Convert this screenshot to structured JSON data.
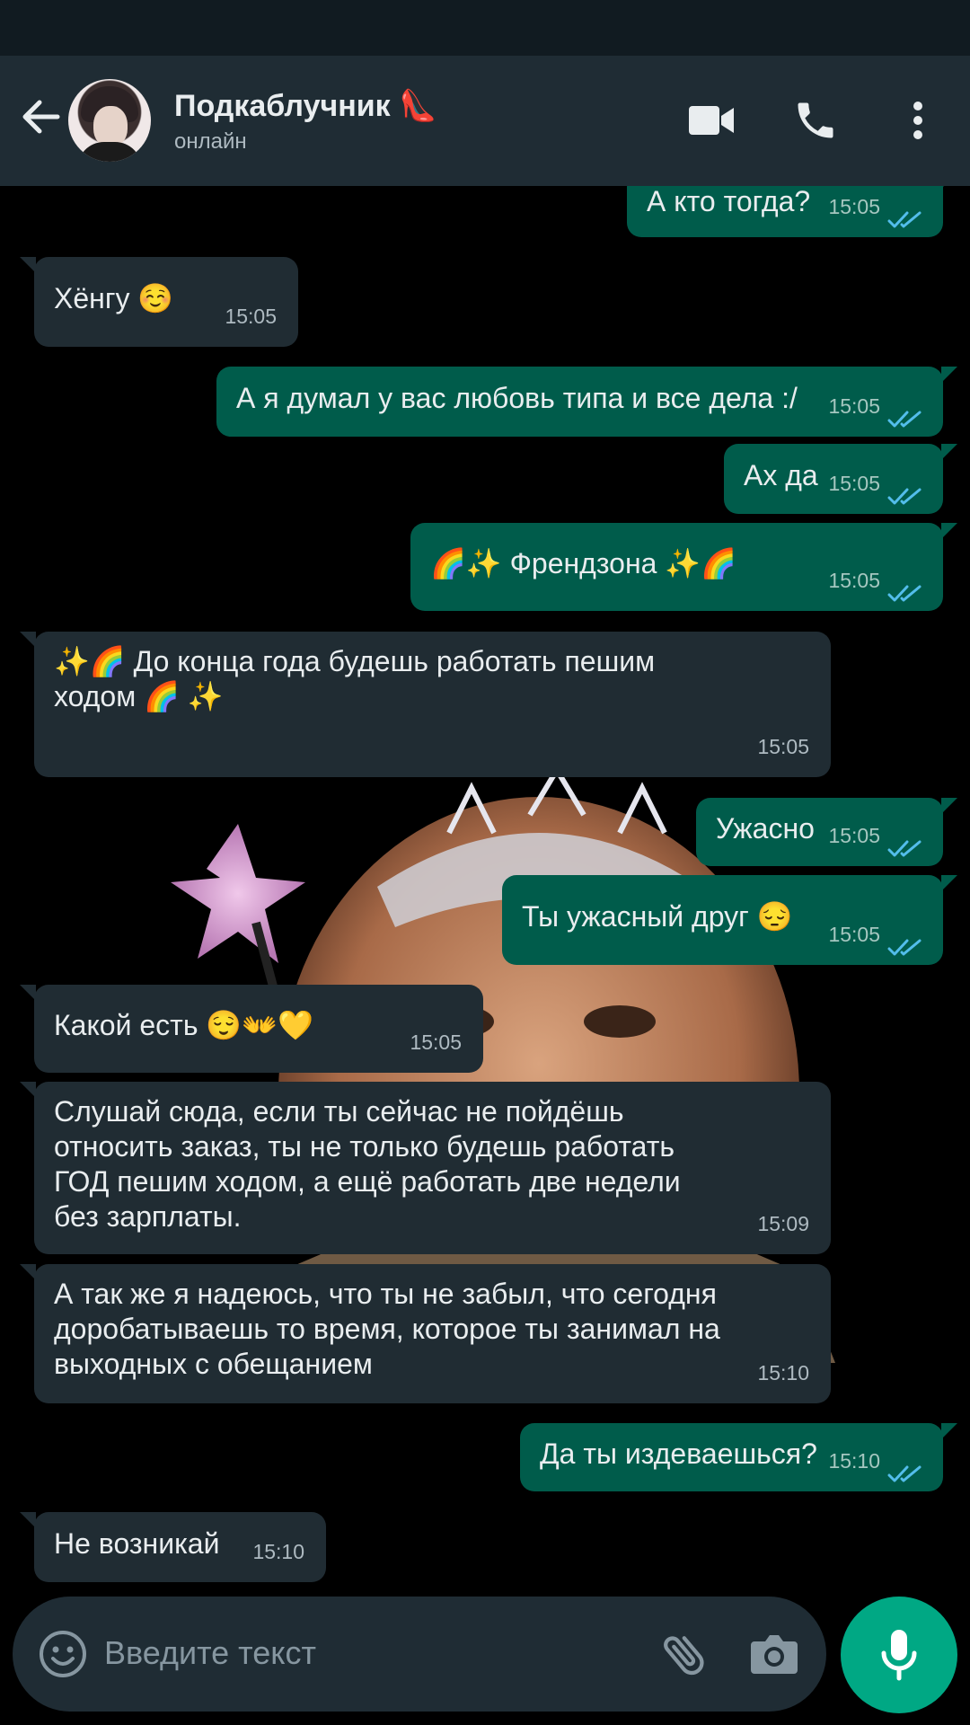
{
  "contact": {
    "name": "Подкаблучник 👠",
    "status": "онлайн"
  },
  "header_icons": [
    "back-arrow-icon",
    "video-call-icon",
    "phone-icon",
    "more-vert-icon"
  ],
  "colors": {
    "header": "#1f2c34",
    "incoming_bubble": "#202c33",
    "outgoing_bubble": "#005c4b",
    "read_ticks": "#53bdeb",
    "mic_button": "#00a884"
  },
  "messages": [
    {
      "dir": "out",
      "text": "А кто тогда?",
      "time": "15:05",
      "read": true
    },
    {
      "dir": "in",
      "text": "Хёнгу ☺️",
      "time": "15:05"
    },
    {
      "dir": "out",
      "text": "А я думал у вас любовь типа и все дела :/",
      "time": "15:05",
      "read": true
    },
    {
      "dir": "out",
      "text": "Ах да",
      "time": "15:05",
      "read": true
    },
    {
      "dir": "out",
      "text": "🌈✨ Френдзона ✨🌈",
      "time": "15:05",
      "read": true
    },
    {
      "dir": "in",
      "text": "✨🌈 До конца года будешь работать пешим\nходом 🌈 ✨",
      "time": "15:05"
    },
    {
      "dir": "out",
      "text": "Ужасно",
      "time": "15:05",
      "read": true
    },
    {
      "dir": "out",
      "text": "Ты ужасный друг 😔",
      "time": "15:05",
      "read": true
    },
    {
      "dir": "in",
      "text": "Какой есть 😌👐💛",
      "time": "15:05"
    },
    {
      "dir": "in",
      "text": "Слушай сюда, если ты сейчас не пойдёшь\nотносить заказ, ты не только будешь работать\nГОД пешим ходом, а ещё работать две недели\nбез зарплаты.",
      "time": "15:09"
    },
    {
      "dir": "in",
      "text": "А так же я надеюсь, что ты не забыл, что сегодня\nдоробатываешь то время, которое ты занимал на\nвыходных с обещанием",
      "time": "15:10"
    },
    {
      "dir": "out",
      "text": "Да ты издеваешься?",
      "time": "15:10",
      "read": true
    },
    {
      "dir": "in",
      "text": "Не возникай",
      "time": "15:10"
    }
  ],
  "composer": {
    "placeholder": "Введите текст",
    "icons": [
      "emoji-icon",
      "attach-icon",
      "camera-icon",
      "mic-icon"
    ]
  }
}
